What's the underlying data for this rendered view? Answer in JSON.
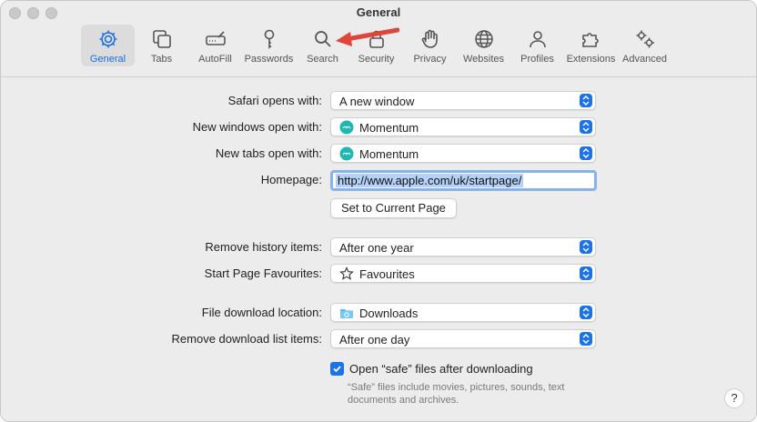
{
  "window": {
    "title": "General"
  },
  "toolbar": {
    "items": [
      {
        "label": "General",
        "icon": "gear-icon"
      },
      {
        "label": "Tabs",
        "icon": "tabs-icon"
      },
      {
        "label": "AutoFill",
        "icon": "autofill-icon"
      },
      {
        "label": "Passwords",
        "icon": "key-icon"
      },
      {
        "label": "Search",
        "icon": "search-icon"
      },
      {
        "label": "Security",
        "icon": "lock-icon"
      },
      {
        "label": "Privacy",
        "icon": "hand-icon"
      },
      {
        "label": "Websites",
        "icon": "globe-icon"
      },
      {
        "label": "Profiles",
        "icon": "person-icon"
      },
      {
        "label": "Extensions",
        "icon": "puzzle-icon"
      },
      {
        "label": "Advanced",
        "icon": "gears-icon"
      }
    ]
  },
  "settings": {
    "safari_opens": {
      "label": "Safari opens with:",
      "value": "A new window"
    },
    "new_windows": {
      "label": "New windows open with:",
      "value": "Momentum"
    },
    "new_tabs": {
      "label": "New tabs open with:",
      "value": "Momentum"
    },
    "homepage": {
      "label": "Homepage:",
      "value": "http://www.apple.com/uk/startpage/"
    },
    "set_current": {
      "label": "Set to Current Page"
    },
    "remove_history": {
      "label": "Remove history items:",
      "value": "After one year"
    },
    "start_page_favs": {
      "label": "Start Page Favourites:",
      "value": "Favourites"
    },
    "download_location": {
      "label": "File download location:",
      "value": "Downloads"
    },
    "remove_downloads": {
      "label": "Remove download list items:",
      "value": "After one day"
    },
    "open_safe": {
      "label": "Open “safe” files after downloading",
      "checked": true
    },
    "safe_hint": "“Safe” files include movies, pictures, sounds, text documents and archives."
  },
  "help": {
    "label": "?"
  },
  "colors": {
    "accent": "#1a73e8",
    "arrow": "#e0453a",
    "momentum": "#1fb7b2"
  }
}
